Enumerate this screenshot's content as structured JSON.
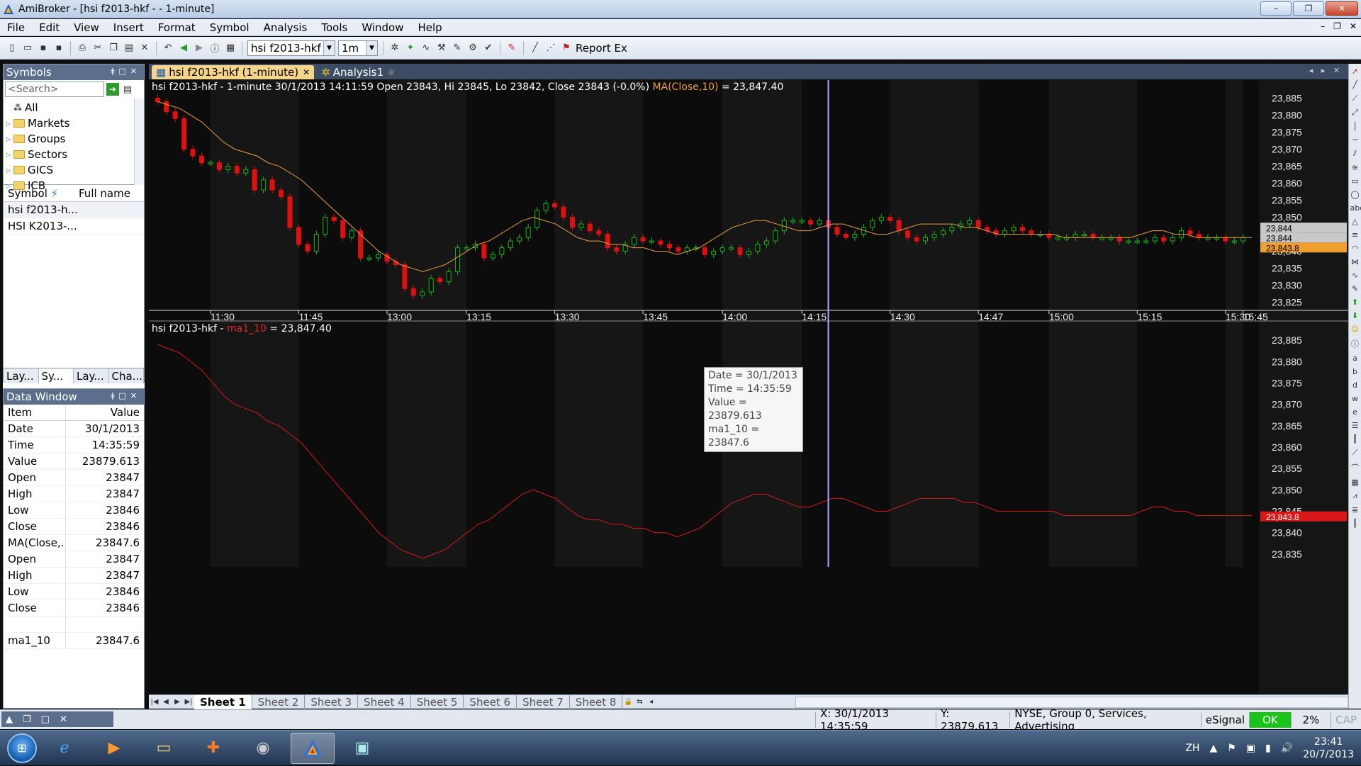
{
  "window": {
    "title": "AmiBroker - [hsi f2013-hkf - - 1-minute]",
    "buttons": [
      "–",
      "❐",
      "✕"
    ]
  },
  "menu": {
    "items": [
      "File",
      "Edit",
      "View",
      "Insert",
      "Format",
      "Symbol",
      "Analysis",
      "Tools",
      "Window",
      "Help"
    ]
  },
  "toolbar": {
    "symbol_combo": "hsi f2013-hkf",
    "interval_combo": "1m",
    "report_label": "Report Ex"
  },
  "symbols_panel": {
    "title": "Symbols",
    "search_placeholder": "<Search>",
    "tree": [
      "All",
      "Markets",
      "Groups",
      "Sectors",
      "GICS",
      "ICB"
    ],
    "columns": [
      "Symbol",
      "Full name"
    ],
    "rows": [
      "hsi f2013-h...",
      "HSI K2013-..."
    ],
    "tabs": [
      "Lay...",
      "Sy...",
      "Lay...",
      "Cha..."
    ]
  },
  "data_window": {
    "title": "Data Window",
    "columns": [
      "Item",
      "Value"
    ],
    "rows": [
      {
        "k": "Date",
        "v": "30/1/2013"
      },
      {
        "k": "Time",
        "v": "14:35:59"
      },
      {
        "k": "Value",
        "v": "23879.613"
      },
      {
        "k": "Open",
        "v": "23847"
      },
      {
        "k": "High",
        "v": "23847"
      },
      {
        "k": "Low",
        "v": "23846"
      },
      {
        "k": "Close",
        "v": "23846"
      },
      {
        "k": "MA(Close,...",
        "v": "23847.6"
      },
      {
        "k": "Open",
        "v": "23847"
      },
      {
        "k": "High",
        "v": "23847"
      },
      {
        "k": "Low",
        "v": "23846"
      },
      {
        "k": "Close",
        "v": "23846"
      },
      {
        "k": "",
        "v": ""
      },
      {
        "k": "ma1_10",
        "v": "23847.6"
      }
    ]
  },
  "doc_tabs": [
    "hsi f2013-hkf (1-minute)",
    "Analysis1"
  ],
  "chart": {
    "price_title": "hsi f2013-hkf - 1-minute 30/1/2013 14:11:59 Open 23843, Hi 23845, Lo 23842, Close 23843 (-0.0%)",
    "price_title_ma": "MA(Close,10)",
    "price_title_ma_value": " = 23,847.40",
    "ma_title_prefix": "hsi f2013-hkf - ",
    "ma_title_name": "ma1_10",
    "ma_title_value": " = 23,847.40",
    "tooltip": [
      "Date = 30/1/2013",
      "Time = 14:35:59",
      "Value = 23879.613",
      "ma1_10 = 23847.6"
    ],
    "last_price_labels": [
      "23,844",
      "23,844",
      "23,843.8"
    ],
    "ma_last_label": "23,843.8",
    "colors": {
      "up": "#19b519",
      "down": "#e01010",
      "ma_top": "#e8a03a",
      "ma_bottom": "#d81818",
      "cursor": "#a9a9ff"
    }
  },
  "chart_data": {
    "type": "candlestick",
    "title": "hsi f2013-hkf - 1-minute",
    "x_tick_labels": [
      "11:30",
      "11:45",
      "13:00",
      "13:15",
      "13:30",
      "13:45",
      "14:00",
      "14:15",
      "14:30",
      "14:47",
      "15:00",
      "15:15",
      "15:30",
      "15:45"
    ],
    "y_tick_labels_top": [
      "23,885",
      "23,880",
      "23,875",
      "23,870",
      "23,865",
      "23,860",
      "23,855",
      "23,850",
      "23,845",
      "23,840",
      "23,835",
      "23,830",
      "23,825"
    ],
    "y_tick_labels_bottom": [
      "23,885",
      "23,880",
      "23,875",
      "23,870",
      "23,865",
      "23,860",
      "23,855",
      "23,850",
      "23,845",
      "23,840",
      "23,835"
    ],
    "ylim_top": [
      23823,
      23887
    ],
    "ylim_bottom": [
      23832,
      23887
    ],
    "close_series": [
      23884,
      23881,
      23879,
      23870,
      23868,
      23866,
      23866,
      23864,
      23865,
      23863,
      23864,
      23858,
      23861,
      23858,
      23856,
      23847,
      23842,
      23840,
      23845,
      23850,
      23849,
      23844,
      23846,
      23838,
      23838,
      23839,
      23837,
      23836,
      23829,
      23827,
      23828,
      23832,
      23831,
      23834,
      23841,
      23841,
      23842,
      23838,
      23839,
      23841,
      23843,
      23844,
      23847,
      23852,
      23854,
      23853,
      23850,
      23847,
      23848,
      23846,
      23845,
      23841,
      23840,
      23842,
      23844,
      23843,
      23843,
      23842,
      23841,
      23840,
      23841,
      23841,
      23839,
      23840,
      23841,
      23841,
      23839,
      23840,
      23842,
      23843,
      23846,
      23849,
      23849,
      23849,
      23848,
      23849,
      23847,
      23845,
      23844,
      23845,
      23847,
      23849,
      23850,
      23849,
      23846,
      23844,
      23843,
      23844,
      23845,
      23846,
      23847,
      23848,
      23849,
      23847,
      23846,
      23845,
      23846,
      23847,
      23846,
      23845,
      23845,
      23844,
      23844,
      23844,
      23845,
      23845,
      23844,
      23844,
      23844,
      23843,
      23843,
      23843,
      23843,
      23844,
      23843,
      23844,
      23846,
      23845,
      23844,
      23844,
      23844,
      23843,
      23843,
      23844
    ],
    "ma10": [
      23884,
      23883,
      23882,
      23880,
      23878,
      23875,
      23872,
      23870,
      23869,
      23868,
      23866,
      23865,
      23863,
      23861,
      23858,
      23855,
      23852,
      23849,
      23846,
      23843,
      23840,
      23838,
      23836,
      23835,
      23834,
      23835,
      23836,
      23838,
      23840,
      23842,
      23843,
      23845,
      23847,
      23849,
      23850,
      23849,
      23848,
      23846,
      23844,
      23843,
      23843,
      23842,
      23842,
      23841,
      23841,
      23840,
      23840,
      23839,
      23840,
      23841,
      23843,
      23845,
      23847,
      23848,
      23849,
      23849,
      23848,
      23847,
      23846,
      23846,
      23847,
      23848,
      23848,
      23847,
      23846,
      23845,
      23845,
      23846,
      23847,
      23848,
      23848,
      23848,
      23848,
      23847,
      23847,
      23846,
      23845,
      23845,
      23845,
      23845,
      23845,
      23845,
      23844,
      23844,
      23844,
      23844,
      23844,
      23844,
      23844,
      23845,
      23846,
      23846,
      23845,
      23845,
      23844,
      23844,
      23844,
      23844,
      23844,
      23844
    ]
  },
  "sheets": [
    "Sheet 1",
    "Sheet 2",
    "Sheet 3",
    "Sheet 4",
    "Sheet 5",
    "Sheet 6",
    "Sheet 7",
    "Sheet 8"
  ],
  "status": {
    "x": "X: 30/1/2013 14:35:59",
    "y": "Y: 23879.613",
    "group": "NYSE, Group 0, Services, Advertising",
    "feed": "eSignal",
    "ok": "OK",
    "pct": "2%",
    "cap": "CAP"
  },
  "taskbar": {
    "lang": "ZH",
    "time": "23:41",
    "date": "20/7/2013"
  }
}
